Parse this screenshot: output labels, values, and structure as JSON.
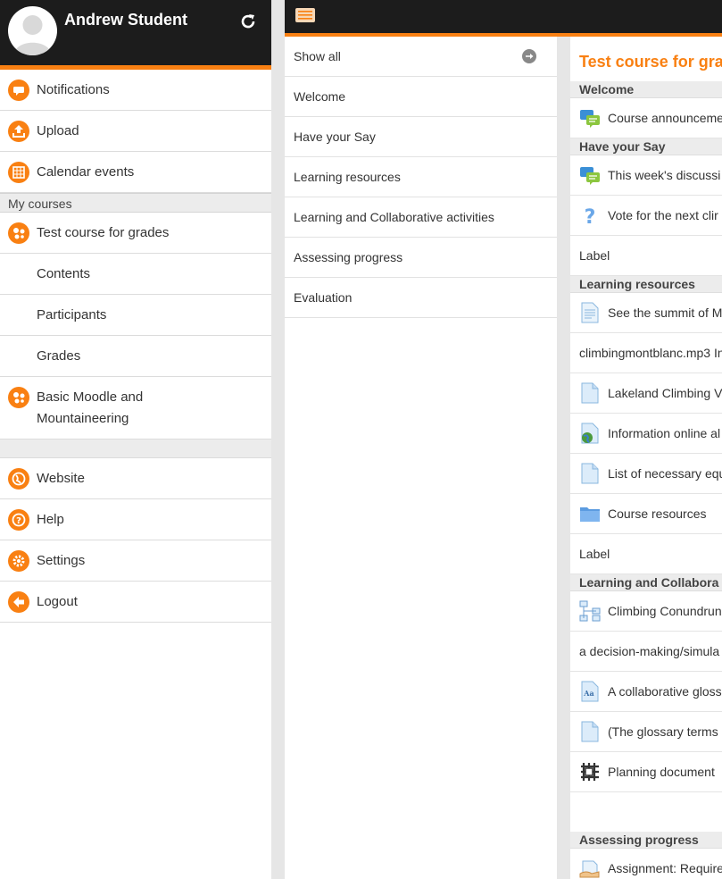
{
  "user": {
    "name": "Andrew Student"
  },
  "drawer": {
    "items": [
      {
        "label": "Notifications",
        "icon": "notifications-icon"
      },
      {
        "label": "Upload",
        "icon": "upload-icon"
      },
      {
        "label": "Calendar events",
        "icon": "calendar-icon"
      }
    ],
    "my_courses_label": "My courses",
    "course1": {
      "label": "Test course for grades",
      "icon": "course-icon"
    },
    "course1_sub": [
      "Contents",
      "Participants",
      "Grades"
    ],
    "course2": {
      "label_line1": "Basic Moodle and",
      "label_line2": "Mountaineering",
      "icon": "course-icon"
    },
    "bottom": [
      {
        "label": "Website",
        "icon": "globe-icon"
      },
      {
        "label": "Help",
        "icon": "help-icon"
      },
      {
        "label": "Settings",
        "icon": "gear-icon"
      },
      {
        "label": "Logout",
        "icon": "logout-icon"
      }
    ]
  },
  "sections": {
    "show_all": "Show all",
    "items": [
      "Welcome",
      "Have your Say",
      "Learning resources",
      "Learning and Collaborative activities",
      "Assessing progress",
      "Evaluation"
    ]
  },
  "content": {
    "title": "Test course for gra",
    "headings": {
      "welcome": "Welcome",
      "have_your_say": "Have your Say",
      "learning_resources": "Learning resources",
      "learning_collab": "Learning and Collabora",
      "assessing": "Assessing progress"
    },
    "rows": {
      "announcements": "Course announceme",
      "discussion": "This week's discussi",
      "vote": "Vote for the next clir",
      "label1": "Label",
      "summit": "See the summit of M",
      "mp3": "climbingmontblanc.mp3 In",
      "lakeland": "Lakeland Climbing V",
      "info_online": "Information online al",
      "list_equipment": "List of necessary equ",
      "course_resources": "Course resources",
      "label2": "Label",
      "conundrum": "Climbing Conundrun",
      "decision": "a decision-making/simula",
      "glossary": "A collaborative gloss",
      "glossary_terms": "(The glossary terms",
      "planning": "Planning document",
      "assignment": "Assignment: Require"
    }
  },
  "colors": {
    "accent": "#f98012",
    "header_bg": "#1c1c1c",
    "forum_blue": "#3a8fd6",
    "forum_green": "#8cc63f"
  }
}
